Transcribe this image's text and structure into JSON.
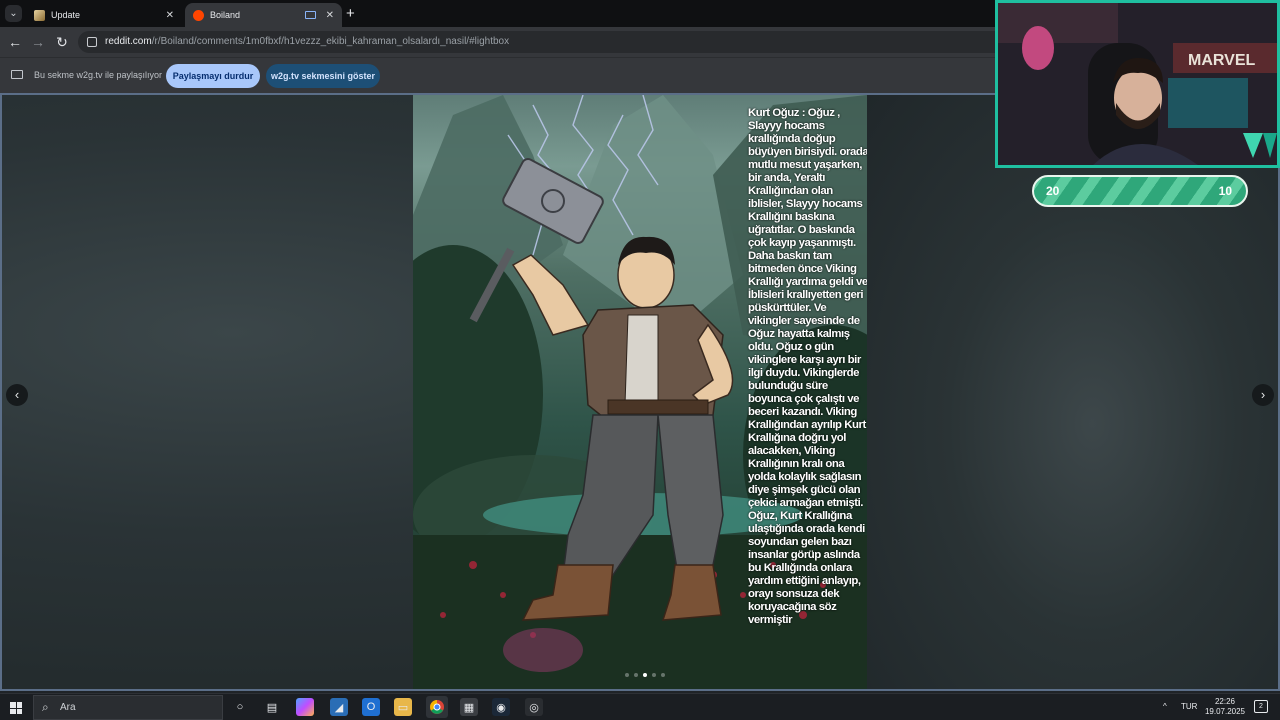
{
  "browser": {
    "tabs": [
      {
        "title": "Update",
        "active": false
      },
      {
        "title": "Boiland",
        "active": true
      }
    ],
    "url": {
      "host": "reddit.com",
      "path": "/r/Boiland/comments/1m0fbxf/h1vezzz_ekibi_kahraman_olsalardı_nasil/#lightbox"
    },
    "share_bar": {
      "notice": "Bu sekme w2g.tv ile paylaşılıyor",
      "stop_label": "Paylaşmayı durdur",
      "show_label": "w2g.tv sekmesini göster"
    }
  },
  "lightbox": {
    "caption": "Kurt Oğuz : Oğuz , Slayyy hocams krallığında doğup büyüyen birisiydi. orada mutlu mesut yaşarken, bir anda, Yeraltı Krallığından olan iblisler, Slayyy hocams Krallığını baskına uğratıtlar. O baskında çok kayıp yaşanmıştı. Daha baskın tam bitmeden önce Viking Krallığı yardıma geldi ve İblisleri krallıyetten geri püskürttüler. Ve vikingler sayesinde de Oğuz hayatta kalmış oldu. Oğuz o gün vikinglere karşı ayrı bir ilgi duydu. Vikinglerde bulunduğu süre boyunca çok çalıştı ve beceri kazandı. Viking Krallığından ayrılıp Kurt Krallığına doğru yol alacakken, Viking Krallığının kralı ona yolda kolaylık sağlasın diye şimşek gücü olan çekici armağan etmişti. Oğuz, Kurt Krallığına ulaştığında orada kendi soyundan gelen bazı insanlar görüp aslında bu Krallığında onlara yardım ettiğini anlayıp, orayı sonsuza dek koruyacağına söz vermiştir",
    "image_count": 5,
    "current_index": 3
  },
  "stream_overlay": {
    "score_left": "20",
    "score_right": "10",
    "camera_poster": "MARVEL"
  },
  "taskbar": {
    "search_placeholder": "Ara",
    "language": "TUR",
    "time": "22:26",
    "date": "19.07.2025",
    "notification_count": "2"
  },
  "colors": {
    "active_button": "#a8c7fa",
    "secondary_button": "#1d4f76",
    "overlay_border": "#1fbfa0",
    "score_bar": "#2fa77a"
  }
}
